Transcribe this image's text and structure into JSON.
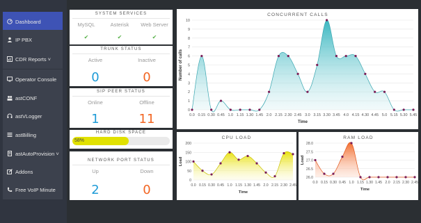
{
  "sidebar": {
    "items": [
      {
        "label": "Dashboard",
        "icon": "dashboard-icon",
        "active": true
      },
      {
        "label": "IP PBX",
        "icon": "user-icon"
      },
      {
        "label": "CDR Reports ˅",
        "icon": "report-icon"
      },
      {
        "label": "Operator Console",
        "icon": "monitor-icon"
      },
      {
        "label": "astCONF",
        "icon": "users-icon"
      },
      {
        "label": "astVLogger",
        "icon": "headset-icon"
      },
      {
        "label": "astBilling",
        "icon": "list-icon"
      },
      {
        "label": "astAutoProvision ˅",
        "icon": "device-icon"
      },
      {
        "label": "Addons",
        "icon": "edit-icon"
      },
      {
        "label": "Free VoIP Minute",
        "icon": "phone-icon"
      }
    ]
  },
  "system_services": {
    "title": "SYSTEM SERVICES",
    "columns": [
      "MySQL",
      "Asterisk",
      "Web Server"
    ],
    "status_icons": [
      "check-icon",
      "check-icon",
      "check-icon"
    ]
  },
  "trunk_status": {
    "title": "TRUNK STATUS",
    "active_label": "Active",
    "inactive_label": "Inactive",
    "active": "0",
    "inactive": "0"
  },
  "sip_peer_status": {
    "title": "SIP PEER STATUS",
    "online_label": "Online",
    "offline_label": "Offline",
    "online": "1",
    "offline": "11"
  },
  "hard_disk": {
    "title": "HARD DISK SPACE",
    "percent_label": "58%",
    "fraction": 0.58
  },
  "network_port": {
    "title": "NETWORK PORT STATUS",
    "up_label": "Up",
    "down_label": "Down",
    "up": "2",
    "down": "0"
  },
  "colors": {
    "accent": "#3e53b5",
    "blue": "#1e9bd7",
    "orange": "#f26522",
    "green": "#59b24a",
    "yellow": "#e1e100",
    "teal": "#32b4be"
  },
  "chart_data": [
    {
      "type": "area",
      "title": "CONCURRENT CALLS",
      "xlabel": "Time",
      "ylabel": "Number of calls",
      "ylim": [
        0,
        10
      ],
      "yticks": [
        "0",
        "1",
        "2",
        "3",
        "4",
        "5",
        "6",
        "7",
        "8",
        "9",
        "10"
      ],
      "x": [
        "0.0",
        "0.15",
        "0.30",
        "0.45",
        "1.0",
        "1.15",
        "1.30",
        "1.45",
        "2.0",
        "2.15",
        "2.30",
        "2.45",
        "3.0",
        "3.15",
        "3.30",
        "3.45",
        "4.0",
        "4.15",
        "4.30",
        "4.45",
        "5.0",
        "5.15",
        "5.30",
        "5.45"
      ],
      "values": [
        0,
        6,
        0,
        1,
        0,
        0,
        0,
        0,
        2,
        6,
        6,
        4,
        2,
        5,
        10,
        6,
        6,
        6,
        4,
        2,
        2,
        0,
        0,
        0
      ]
    },
    {
      "type": "area",
      "title": "CPU LOAD",
      "xlabel": "Time",
      "ylabel": "Load",
      "ylim": [
        0,
        200
      ],
      "yticks": [
        "0",
        "50",
        "100",
        "150",
        "200"
      ],
      "x": [
        "0.0",
        "0.15",
        "0.30",
        "0.45",
        "1.0",
        "1.15",
        "1.30",
        "1.45",
        "2.0",
        "2.15",
        "2.30",
        "2.45"
      ],
      "values": [
        100,
        50,
        30,
        90,
        150,
        110,
        130,
        90,
        40,
        20,
        145,
        140
      ]
    },
    {
      "type": "area",
      "title": "RAM LOAD",
      "xlabel": "Time",
      "ylabel": "Load",
      "ylim": [
        26.0,
        28.0
      ],
      "yticks": [
        "26.0",
        "26.5",
        "27.0",
        "27.5",
        "28.0"
      ],
      "x": [
        "0.0",
        "0.15",
        "0.30",
        "0.45",
        "1.0",
        "1.15",
        "1.30",
        "1.45",
        "2.0",
        "2.15",
        "2.30",
        "2.45"
      ],
      "values": [
        27.0,
        26.2,
        26.2,
        27.2,
        28.0,
        26.0,
        26.0,
        26.0,
        26.0,
        26.0,
        26.0,
        26.0
      ]
    }
  ]
}
